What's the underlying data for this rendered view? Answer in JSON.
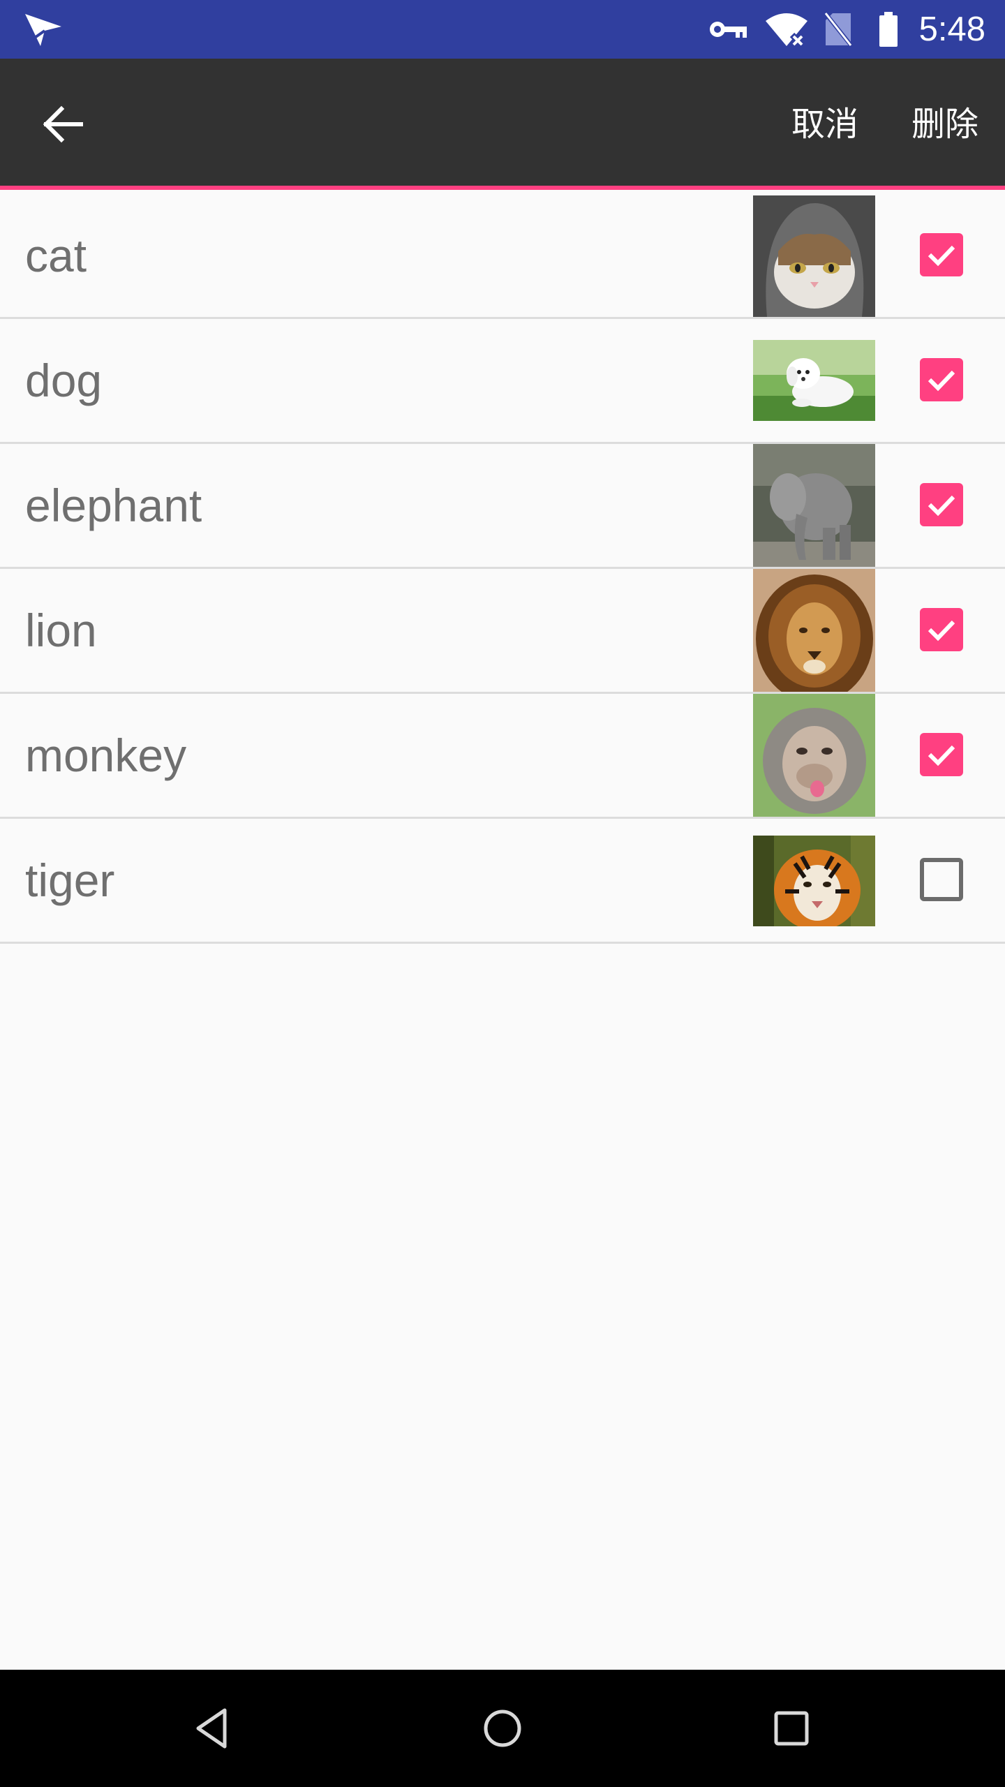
{
  "colors": {
    "status_bar": "#303f9f",
    "toolbar": "#323232",
    "accent": "#ff4081",
    "background": "#fafafa",
    "divider": "#dcdcdc",
    "label_text": "#6f6f6f"
  },
  "status_bar": {
    "left_icon": "send-icon",
    "icons": [
      "vpn-key-icon",
      "wifi-icon",
      "no-sim-icon",
      "battery-icon"
    ],
    "time": "5:48"
  },
  "toolbar": {
    "back_icon": "arrow-back-icon",
    "cancel_label": "取消",
    "delete_label": "删除"
  },
  "items": [
    {
      "label": "cat",
      "image": "cat-photo",
      "checked": true
    },
    {
      "label": "dog",
      "image": "dog-photo",
      "checked": true
    },
    {
      "label": "elephant",
      "image": "elephant-photo",
      "checked": true
    },
    {
      "label": "lion",
      "image": "lion-photo",
      "checked": true
    },
    {
      "label": "monkey",
      "image": "monkey-photo",
      "checked": true
    },
    {
      "label": "tiger",
      "image": "tiger-photo",
      "checked": false
    }
  ],
  "nav_bar": {
    "buttons": [
      "back-triangle-icon",
      "home-circle-icon",
      "recents-square-icon"
    ]
  }
}
